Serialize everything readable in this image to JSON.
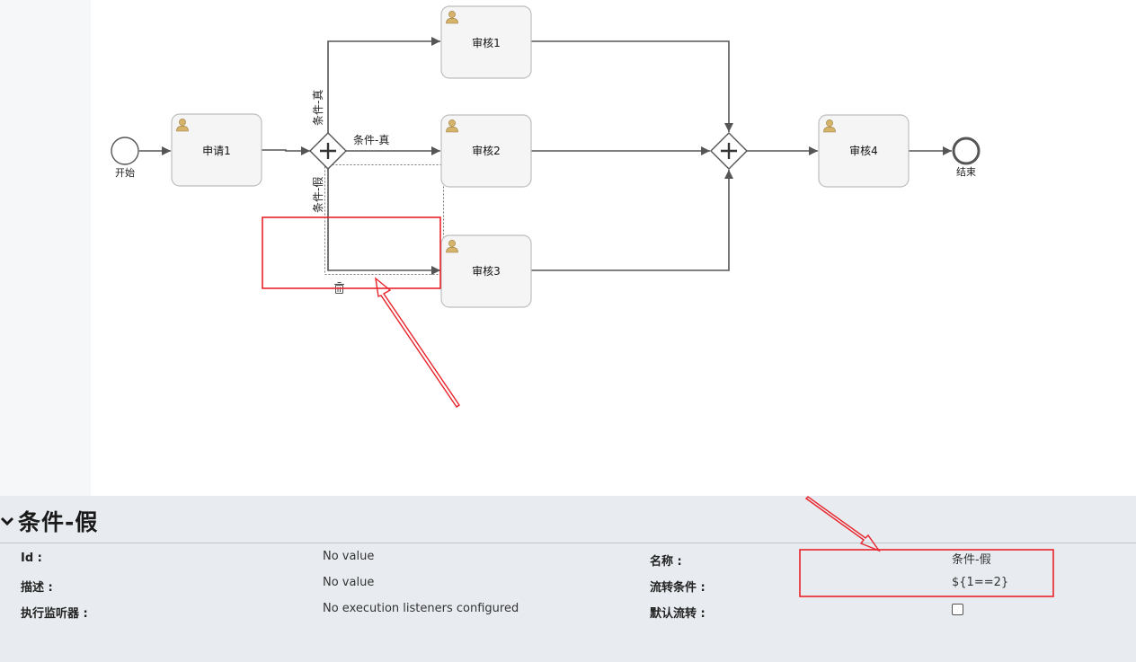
{
  "diagram": {
    "tasks": [
      {
        "id": "apply1",
        "label": "申请1"
      },
      {
        "id": "review1",
        "label": "审核1"
      },
      {
        "id": "review2",
        "label": "审核2"
      },
      {
        "id": "review3",
        "label": "审核3"
      },
      {
        "id": "review4",
        "label": "审核4"
      }
    ],
    "start_label": "开始",
    "end_label": "结束",
    "flows": {
      "true_upper": "条件-真",
      "true_middle": "条件-真",
      "false_lower": "条件-假"
    },
    "colors": {
      "task_fill": "#f5f5f5",
      "task_stroke": "#bdbdbd",
      "flow": "#555555",
      "user_icon": "#d6b36a",
      "highlight": "#e8232b"
    },
    "delete_icon": "trash-icon",
    "user_icon": "user-icon"
  },
  "properties": {
    "title": "条件-假",
    "id_label": "Id :",
    "id_value": "No value",
    "desc_label": "描述 :",
    "desc_value": "No value",
    "listener_label": "执行监听器 :",
    "listener_value": "No execution listeners configured",
    "name_label": "名称 :",
    "name_value": "条件-假",
    "condition_label": "流转条件 :",
    "condition_value": "${1==2}",
    "default_flow_label": "默认流转 :",
    "default_flow_checked": false
  }
}
